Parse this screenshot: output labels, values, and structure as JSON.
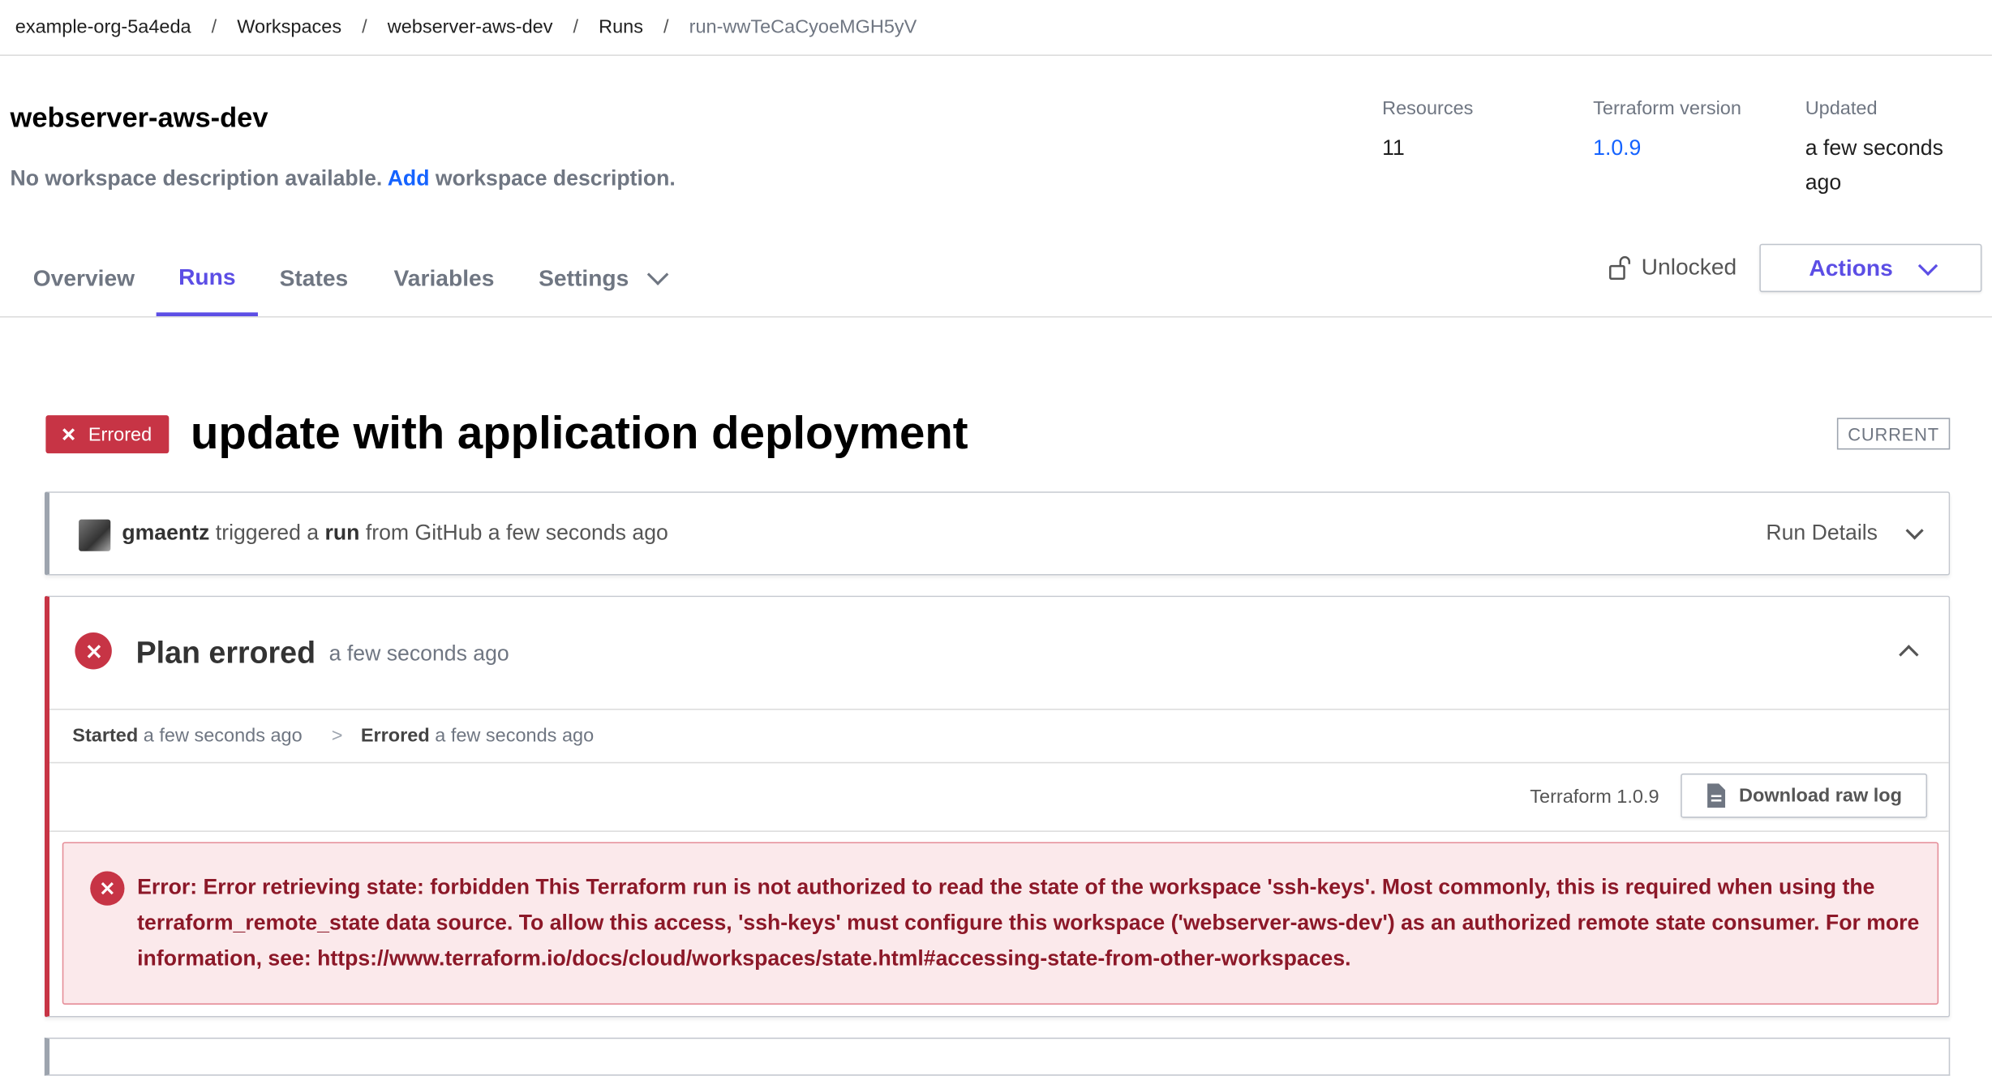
{
  "breadcrumb": {
    "org": "example-org-5a4eda",
    "workspaces": "Workspaces",
    "workspace": "webserver-aws-dev",
    "runs": "Runs",
    "run_id": "run-wwTeCaCyoeMGH5yV",
    "separator": "/"
  },
  "workspace": {
    "name": "webserver-aws-dev",
    "desc_prefix": "No workspace description available.",
    "desc_link": "Add",
    "desc_suffix": "workspace description."
  },
  "meta": {
    "resources_label": "Resources",
    "resources_value": "11",
    "tf_version_label": "Terraform version",
    "tf_version_value": "1.0.9",
    "updated_label": "Updated",
    "updated_value": "a few seconds ago"
  },
  "tabs": [
    {
      "label": "Overview",
      "active": false
    },
    {
      "label": "Runs",
      "active": true
    },
    {
      "label": "States",
      "active": false
    },
    {
      "label": "Variables",
      "active": false
    },
    {
      "label": "Settings",
      "active": false
    }
  ],
  "lock": {
    "label": "Unlocked",
    "icon": "unlock-icon"
  },
  "actions": {
    "label": "Actions"
  },
  "run": {
    "status_badge": "Errored",
    "title": "update with application deployment",
    "current_tag": "CURRENT"
  },
  "trigger": {
    "user": "gmaentz",
    "text1": "triggered a",
    "run_word": "run",
    "text2": "from GitHub a few seconds ago",
    "details_label": "Run Details"
  },
  "plan": {
    "title": "Plan errored",
    "time": "a few seconds ago",
    "started_label": "Started",
    "started_time": "a few seconds ago",
    "arrow": ">",
    "errored_label": "Errored",
    "errored_time": "a few seconds ago",
    "tf_version": "Terraform 1.0.9",
    "download_label": "Download raw log",
    "error_message": "Error: Error retrieving state: forbidden This Terraform run is not authorized to read the state of the workspace 'ssh-keys'. Most commonly, this is required when using the terraform_remote_state data source. To allow this access, 'ssh-keys' must configure this workspace ('webserver-aws-dev') as an authorized remote state consumer. For more information, see: https://www.terraform.io/docs/cloud/workspaces/state.html#accessing-state-from-other-workspaces."
  },
  "colors": {
    "accent": "#5c4ee5",
    "link": "#1563ff",
    "error": "#c73445",
    "error_bg": "#fbe9eb",
    "error_text": "#8c1828"
  }
}
